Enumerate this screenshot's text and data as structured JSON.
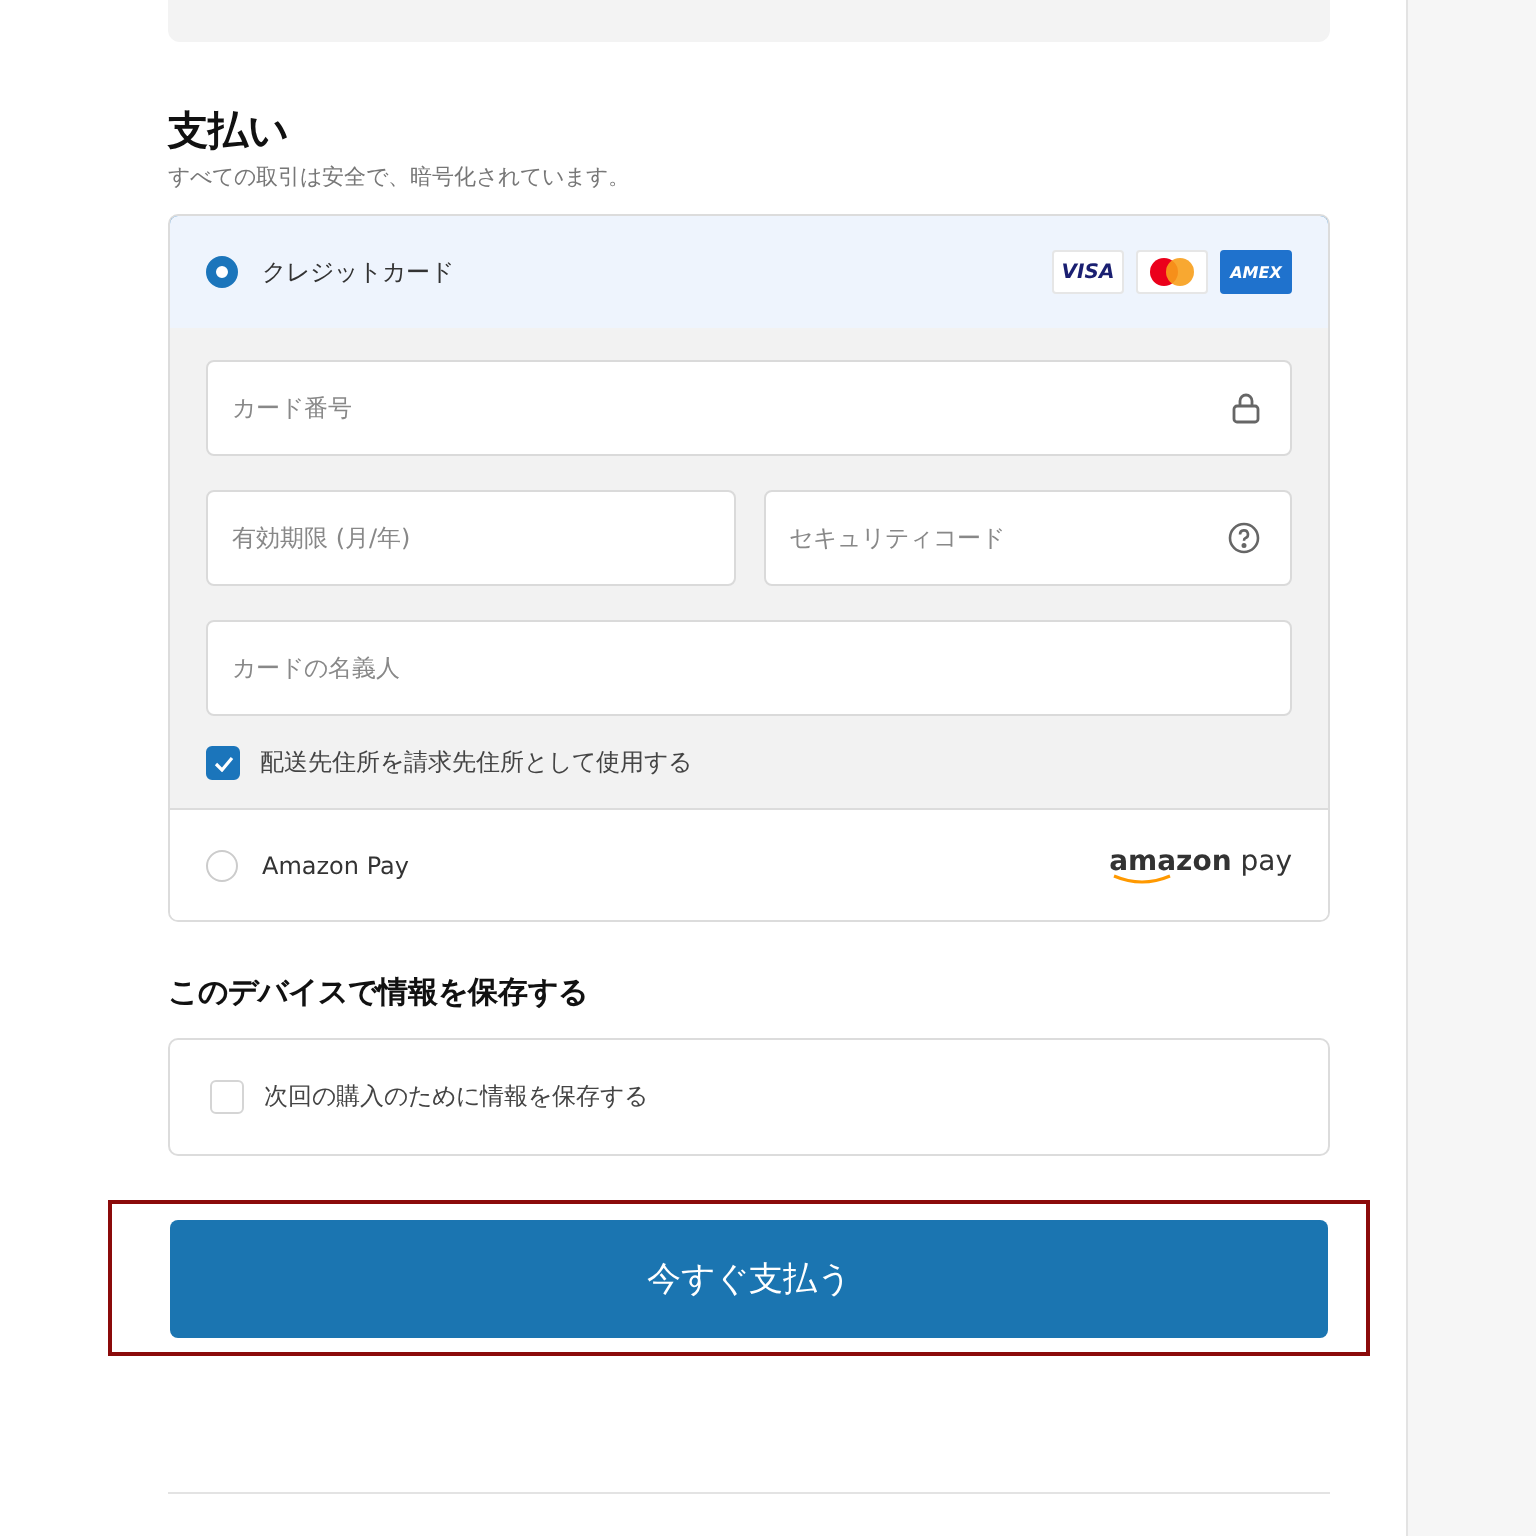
{
  "payment": {
    "title": "支払い",
    "subtitle": "すべての取引は安全で、暗号化されています。",
    "methods": [
      {
        "kind": "card",
        "label": "クレジットカード",
        "selected": true,
        "brands": [
          {
            "kind": "visa",
            "text": "VISA"
          },
          {
            "kind": "mastercard"
          },
          {
            "kind": "amex",
            "text": "AMEX"
          }
        ],
        "fields": [
          {
            "kind": "card_number",
            "placeholder": "カード番号"
          },
          {
            "kind": "expiry",
            "placeholder": "有効期限 (月/年)"
          },
          {
            "kind": "security_code",
            "placeholder": "セキュリティコード"
          },
          {
            "kind": "holder",
            "placeholder": "カードの名義人"
          }
        ],
        "billing_checkbox": {
          "label": "配送先住所を請求先住所として使用する",
          "checked": true
        }
      },
      {
        "kind": "amazon",
        "label": "Amazon Pay",
        "selected": false,
        "logo": "**amazon** pay"
      }
    ]
  },
  "save": {
    "title": "このデバイスで情報を保存する",
    "checkbox": {
      "label": "次回の購入のために情報を保存する",
      "checked": false
    }
  },
  "pay_button": {
    "label": "今すぐ支払う",
    "highlighted": true
  }
}
